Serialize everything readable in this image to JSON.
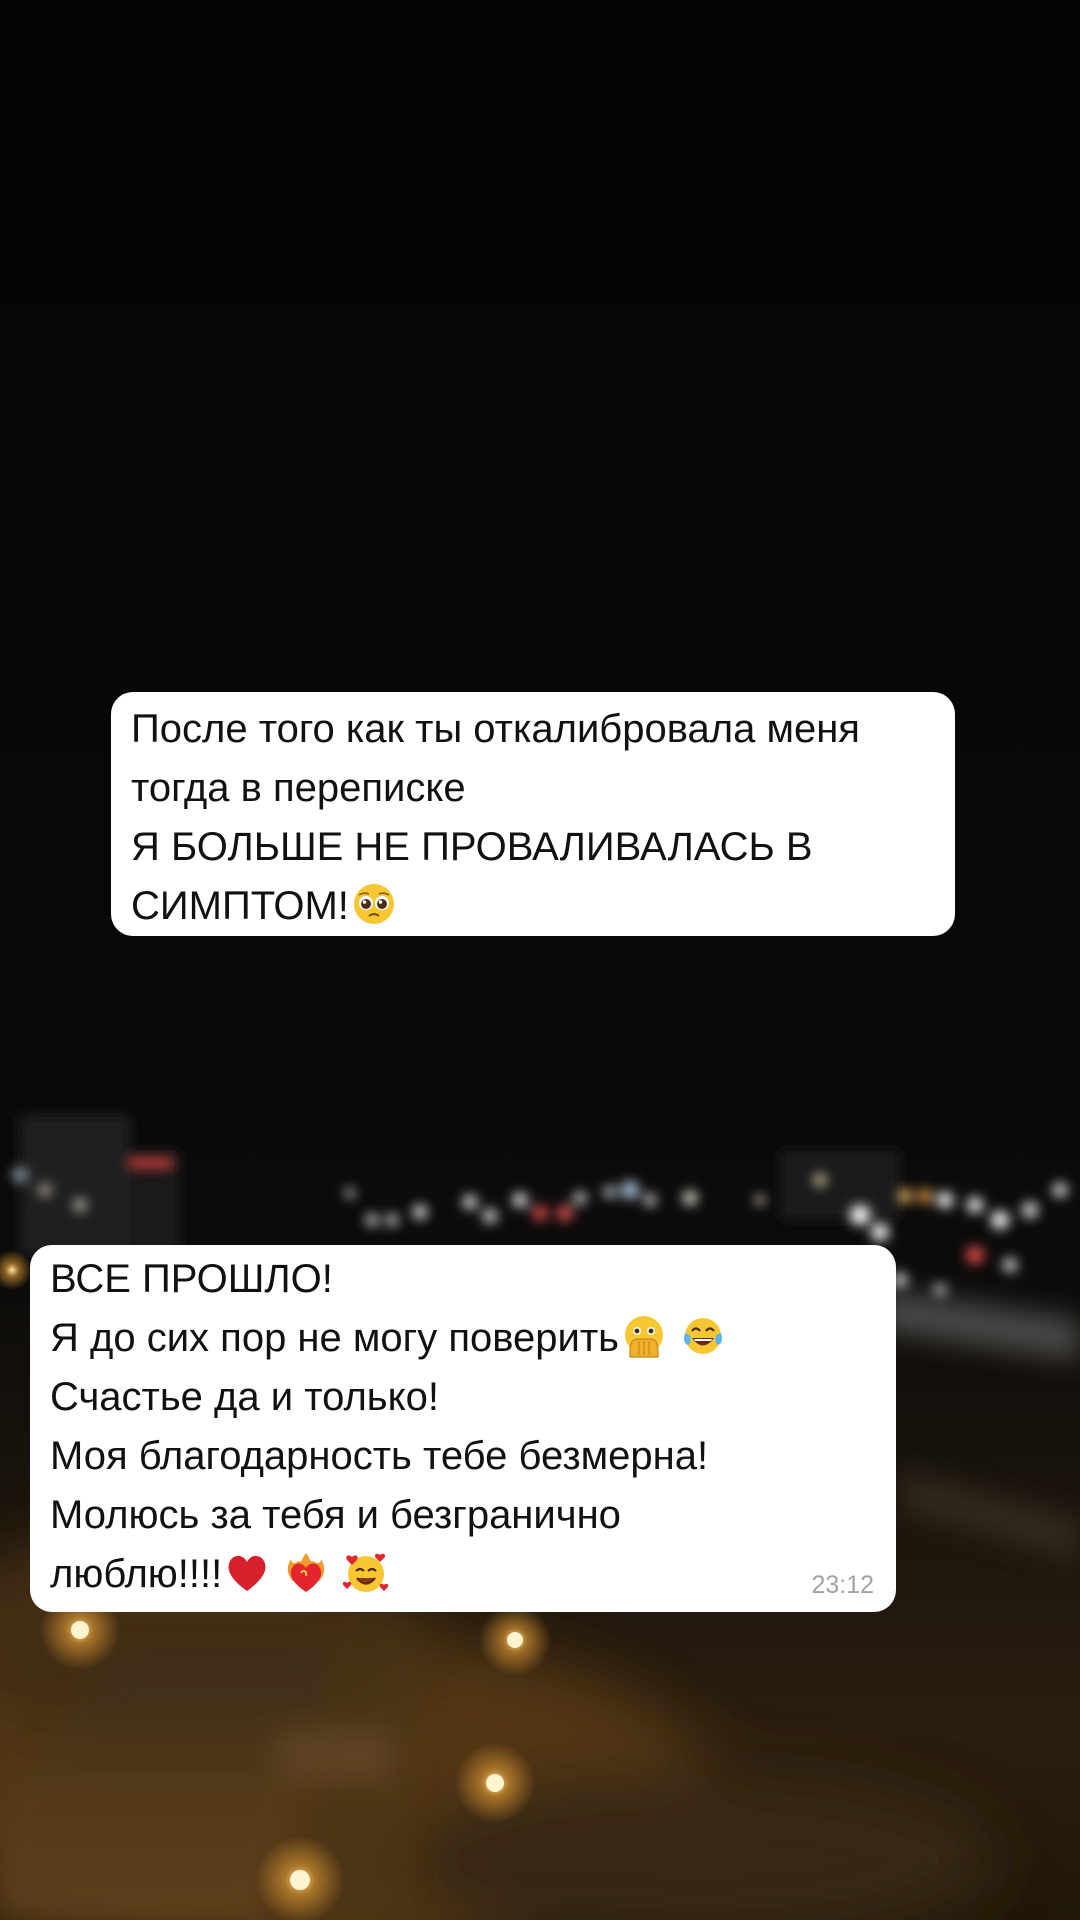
{
  "messages": [
    {
      "lines": [
        "После того как ты откалибровала меня",
        "тогда в переписке",
        "Я БОЛЬШЕ НЕ ПРОВАЛИВАЛАСЬ В",
        "СИМПТОМ!"
      ],
      "emojis": [
        "pleading-face-emoji"
      ]
    },
    {
      "lines": [
        "ВСЕ ПРОШЛО!",
        "Я до сих пор не могу поверить",
        "Счастье да и только!",
        "Моя благодарность тебе безмерна!",
        "Молюсь за тебя и безгранично",
        "люблю!!!!"
      ],
      "emojis": [
        "face-with-open-eyes-and-hand-over-mouth-emoji",
        "face-with-tears-of-joy-emoji",
        "red-heart-emoji",
        "heart-on-fire-emoji",
        "smiling-face-with-hearts-emoji"
      ],
      "time": "23:12"
    }
  ],
  "colors": {
    "bubble": "#ffffff",
    "text": "#111111",
    "timestamp": "#a3a3a3",
    "heart": "#d8202c"
  }
}
